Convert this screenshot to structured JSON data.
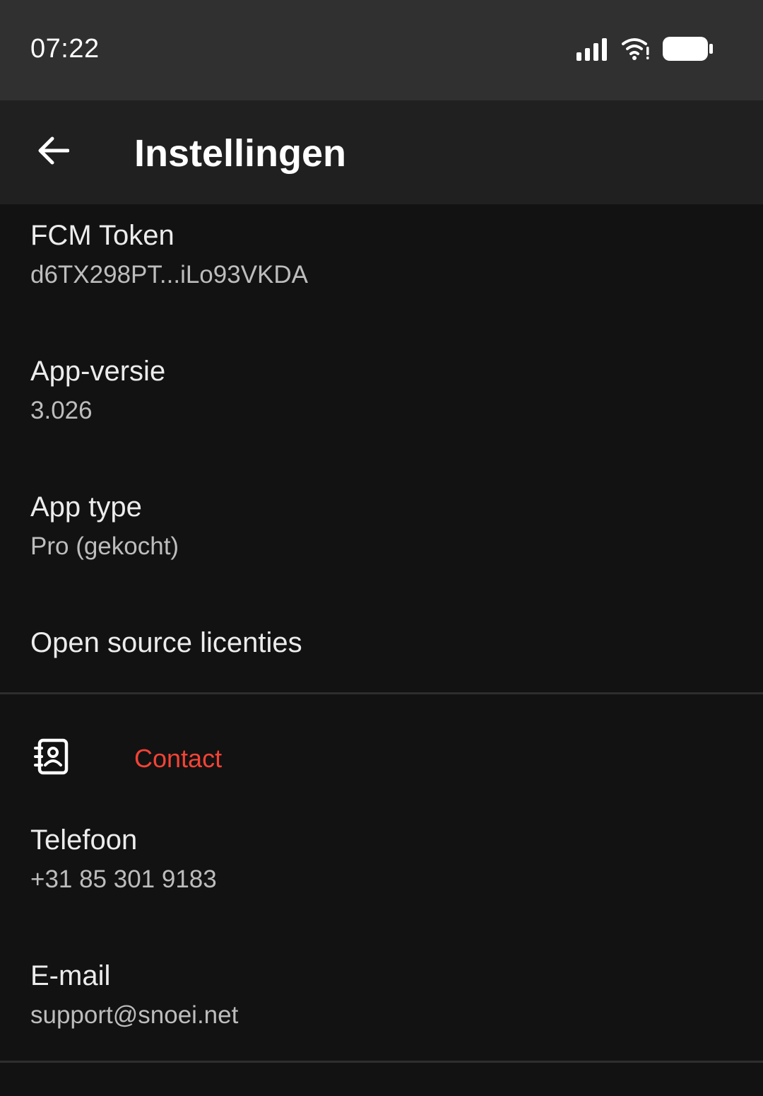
{
  "status_bar": {
    "time": "07:22",
    "icons": [
      "signal-icon",
      "wifi-icon",
      "battery-icon"
    ]
  },
  "app_bar": {
    "back_icon": "arrow-left-icon",
    "title": "Instellingen"
  },
  "items": [
    {
      "title": "FCM Token",
      "summary": "d6TX298PT...iLo93VKDA"
    },
    {
      "title": "App-versie",
      "summary": "3.026"
    },
    {
      "title": "App type",
      "summary": "Pro (gekocht)"
    },
    {
      "title": "Open source licenties"
    }
  ],
  "contact_category": {
    "icon": "contact-book-icon",
    "title": "Contact",
    "accent_color": "#f44336"
  },
  "contact_items": [
    {
      "title": "Telefoon",
      "summary": "+31 85 301 9183"
    },
    {
      "title": "E-mail",
      "summary": "support@snoei.net"
    }
  ]
}
